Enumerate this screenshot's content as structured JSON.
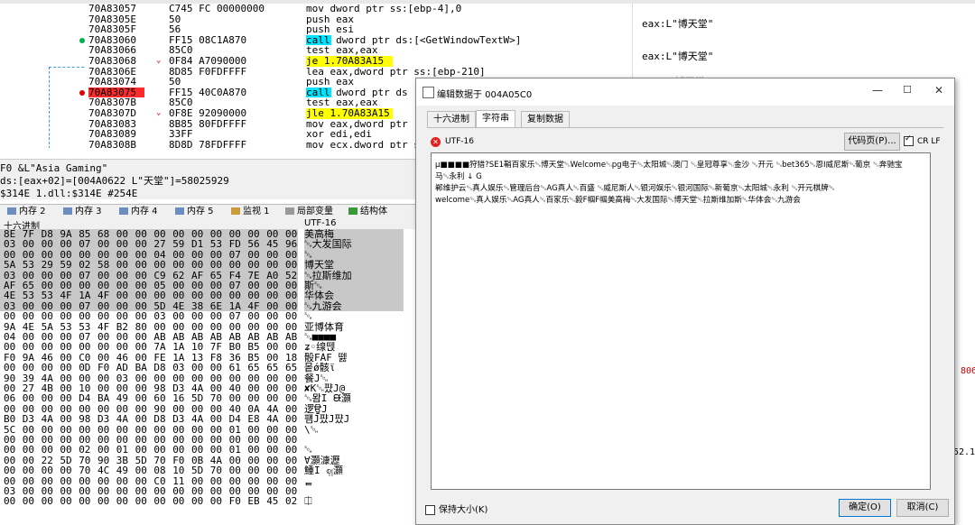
{
  "disasm": [
    {
      "addr": "70A83057",
      "bytes": "C745 FC 00000000",
      "ins": "mov dword ptr ss:[ebp-4],0",
      "call": false,
      "jmp": false,
      "dot": ""
    },
    {
      "addr": "70A8305E",
      "bytes": "50",
      "ins": "push eax",
      "call": false,
      "jmp": false,
      "dot": ""
    },
    {
      "addr": "70A8305F",
      "bytes": "56",
      "ins": "push esi",
      "call": false,
      "jmp": false,
      "dot": ""
    },
    {
      "addr": "70A83060",
      "bytes": "FF15 08C1A870",
      "ins": "call dword ptr ds:[<GetWindowTextW>]",
      "call": true,
      "jmp": false,
      "dot": "green"
    },
    {
      "addr": "70A83066",
      "bytes": "85C0",
      "ins": "test eax,eax",
      "call": false,
      "jmp": false,
      "dot": ""
    },
    {
      "addr": "70A83068",
      "bytes": "0F84 A7090000",
      "ins": "je 1.70A83A15",
      "call": false,
      "jmp": true,
      "dot": ""
    },
    {
      "addr": "70A8306E",
      "bytes": "8D85 F0FDFFFF",
      "ins": "lea eax,dword ptr ss:[ebp-210]",
      "call": false,
      "jmp": false,
      "dot": ""
    },
    {
      "addr": "70A83074",
      "bytes": "50",
      "ins": "push eax",
      "call": false,
      "jmp": false,
      "dot": ""
    },
    {
      "addr": "70A83075",
      "bytes": "FF15 40C0A870",
      "ins": "call dword ptr ds",
      "call": true,
      "jmp": false,
      "dot": "red"
    },
    {
      "addr": "70A8307B",
      "bytes": "85C0",
      "ins": "test eax,eax",
      "call": false,
      "jmp": false,
      "dot": ""
    },
    {
      "addr": "70A8307D",
      "bytes": "0F8E 92090000",
      "ins": "jle 1.70A83A15",
      "call": false,
      "jmp": true,
      "dot": ""
    },
    {
      "addr": "70A83083",
      "bytes": "8B85 80FDFFFF",
      "ins": "mov eax,dword ptr",
      "call": false,
      "jmp": false,
      "dot": ""
    },
    {
      "addr": "70A83089",
      "bytes": "33FF",
      "ins": "xor edi,edi",
      "call": false,
      "jmp": false,
      "dot": ""
    },
    {
      "addr": "70A8308B",
      "bytes": "8D8D 78FDFFFF",
      "ins": "mov ecx,dword ptr ss:[e",
      "call": false,
      "jmp": false,
      "dot": ""
    }
  ],
  "regs": [
    "eax:L\"博天堂\"",
    "eax:L\"博天堂\"",
    "\"博天堂\""
  ],
  "info": [
    "F0 &L\"Asia Gaming\"",
    "ds:[eax+02]=[004A0622 L\"天堂\"]=58025929",
    "$314E 1.dll:$314E #254E"
  ],
  "memtabs": [
    "内存 2",
    "内存 3",
    "内存 4",
    "内存 5",
    "监视 1",
    "局部变量",
    "结构体"
  ],
  "hex_header": {
    "left": "十六进制",
    "right": "UTF-16"
  },
  "hex_rows": [
    {
      "b": [
        "8E",
        "7F",
        "D8",
        "9A",
        "85",
        "68",
        "00",
        "00",
        "00",
        "00",
        "00",
        "00",
        "00",
        "00",
        "00",
        "00"
      ],
      "u": "美高梅"
    },
    {
      "b": [
        "03",
        "00",
        "00",
        "00",
        "07",
        "00",
        "00",
        "00",
        "27",
        "59",
        "D1",
        "53",
        "FD",
        "56",
        "45",
        "96"
      ],
      "u": "␁大发国际"
    },
    {
      "b": [
        "00",
        "00",
        "00",
        "00",
        "00",
        "00",
        "00",
        "00",
        "04",
        "00",
        "00",
        "00",
        "07",
        "00",
        "00",
        "00"
      ],
      "u": "␁"
    },
    {
      "b": [
        "5A",
        "53",
        "29",
        "59",
        "02",
        "58",
        "00",
        "00",
        "00",
        "00",
        "00",
        "00",
        "00",
        "00",
        "00",
        "00"
      ],
      "u": "博天堂"
    },
    {
      "b": [
        "03",
        "00",
        "00",
        "00",
        "07",
        "00",
        "00",
        "00",
        "C9",
        "62",
        "AF",
        "65",
        "F4",
        "7E",
        "A0",
        "52"
      ],
      "u": "␁拉斯维加"
    },
    {
      "b": [
        "AF",
        "65",
        "00",
        "00",
        "00",
        "00",
        "00",
        "00",
        "05",
        "00",
        "00",
        "00",
        "07",
        "00",
        "00",
        "00"
      ],
      "u": "斯␁"
    },
    {
      "b": [
        "4E",
        "53",
        "53",
        "4F",
        "1A",
        "4F",
        "00",
        "00",
        "00",
        "00",
        "00",
        "00",
        "00",
        "00",
        "00",
        "00"
      ],
      "u": "华体会"
    },
    {
      "b": [
        "03",
        "00",
        "00",
        "00",
        "07",
        "00",
        "00",
        "00",
        "5D",
        "4E",
        "38",
        "6E",
        "1A",
        "4F",
        "00",
        "00"
      ],
      "u": "␁九游会"
    },
    {
      "b": [
        "00",
        "00",
        "00",
        "00",
        "00",
        "00",
        "00",
        "00",
        "03",
        "00",
        "00",
        "00",
        "07",
        "00",
        "00",
        "00"
      ],
      "u": "␁"
    },
    {
      "b": [
        "9A",
        "4E",
        "5A",
        "53",
        "53",
        "4F",
        "B2",
        "80",
        "00",
        "00",
        "00",
        "00",
        "00",
        "00",
        "00",
        "00"
      ],
      "u": "亚博体育"
    },
    {
      "b": [
        "04",
        "00",
        "00",
        "00",
        "07",
        "00",
        "00",
        "00",
        "AB",
        "AB",
        "AB",
        "AB",
        "AB",
        "AB",
        "AB",
        "AB"
      ],
      "u": "␁■■■■"
    },
    {
      "b": [
        "00",
        "00",
        "00",
        "00",
        "00",
        "00",
        "00",
        "00",
        "7A",
        "1A",
        "10",
        "7F",
        "B0",
        "B5",
        "00",
        "00"
      ],
      "u": "ʑ◦缐뗁"
    },
    {
      "b": [
        "F0",
        "9A",
        "46",
        "00",
        "C0",
        "00",
        "46",
        "00",
        "FE",
        "1A",
        "13",
        "F8",
        "36",
        "B5",
        "00",
        "18"
      ],
      "u": "骰FÀF︚ 뗋"
    },
    {
      "b": [
        "00",
        "00",
        "00",
        "00",
        "0D",
        "F0",
        "AD",
        "BA",
        "D8",
        "03",
        "00",
        "00",
        "61",
        "65",
        "65",
        "65"
      ],
      "u": "뫁ǿ骸ϊ"
    },
    {
      "b": [
        "90",
        "39",
        "4A",
        "00",
        "00",
        "00",
        "03",
        "00",
        "00",
        "00",
        "00",
        "00",
        "00",
        "00",
        "00",
        "00"
      ],
      "u": "餐J␁"
    },
    {
      "b": [
        "00",
        "27",
        "4B",
        "00",
        "10",
        "00",
        "00",
        "00",
        "98",
        "D3",
        "4A",
        "00",
        "40",
        "00",
        "00",
        "00"
      ],
      "u": "✘K␁퍘J@"
    },
    {
      "b": [
        "06",
        "00",
        "00",
        "00",
        "D4",
        "BA",
        "49",
        "00",
        "60",
        "16",
        "5D",
        "70",
        "00",
        "00",
        "00",
        "00"
      ],
      "u": "␁뫔I ᙠ灝"
    },
    {
      "b": [
        "00",
        "00",
        "00",
        "00",
        "00",
        "00",
        "00",
        "00",
        "90",
        "00",
        "00",
        "00",
        "40",
        "0A",
        "4A",
        "00"
      ],
      "u": "逻ਊJ"
    },
    {
      "b": [
        "B0",
        "D3",
        "4A",
        "00",
        "98",
        "D3",
        "4A",
        "00",
        "D8",
        "D3",
        "4A",
        "00",
        "D4",
        "E8",
        "4A",
        "00"
      ],
      "u": "퍰J퍘J퍘J"
    },
    {
      "b": [
        "5C",
        "00",
        "00",
        "00",
        "00",
        "00",
        "00",
        "00",
        "00",
        "00",
        "00",
        "00",
        "01",
        "00",
        "00",
        "00"
      ],
      "u": "\\␁"
    },
    {
      "b": [
        "00",
        "00",
        "00",
        "00",
        "00",
        "00",
        "00",
        "00",
        "00",
        "00",
        "00",
        "00",
        "00",
        "00",
        "00",
        "00"
      ],
      "u": ""
    },
    {
      "b": [
        "00",
        "00",
        "00",
        "00",
        "02",
        "00",
        "01",
        "00",
        "00",
        "00",
        "00",
        "00",
        "01",
        "00",
        "00",
        "00"
      ],
      "u": "␁"
    },
    {
      "b": [
        "00",
        "00",
        "22",
        "5D",
        "70",
        "90",
        "3B",
        "5D",
        "70",
        "F0",
        "0B",
        "4A",
        "00",
        "00",
        "00",
        "00"
      ],
      "u": "∀灝漮瀝"
    },
    {
      "b": [
        "00",
        "00",
        "00",
        "00",
        "70",
        "4C",
        "49",
        "00",
        "08",
        "10",
        "5D",
        "70",
        "00",
        "00",
        "00",
        "00"
      ],
      "u": "䱰I ဈ灝"
    },
    {
      "b": [
        "00",
        "00",
        "00",
        "00",
        "00",
        "00",
        "00",
        "00",
        "C0",
        "11",
        "00",
        "00",
        "00",
        "00",
        "00",
        "00"
      ],
      "u": "ᇀ"
    },
    {
      "b": [
        "03",
        "00",
        "00",
        "00",
        "00",
        "00",
        "00",
        "00",
        "00",
        "00",
        "00",
        "00",
        "00",
        "00",
        "00",
        "00"
      ],
      "u": ""
    },
    {
      "b": [
        "00",
        "00",
        "00",
        "00",
        "00",
        "00",
        "00",
        "00",
        "00",
        "00",
        "00",
        "00",
        "F0",
        "EB",
        "45",
        "02"
      ],
      "u": "⎅"
    }
  ],
  "dialog": {
    "title": "编辑数据于 004A05C0",
    "tabs": [
      "十六进制",
      "字符串",
      "复制数据"
    ],
    "encoding": "UTF-16",
    "codepage_button": "代码页(P)...",
    "crlf_label": "CR LF",
    "lines": [
      "μ■■■■狩猎?SE1鞘百家乐␁博天堂␁Welcome␁pg电子␁太阳城␁澳门 ␁皇冠尊享␁金沙 ␁开元 ␁bet365␁恩I威尼斯␁葡京 ␁奔驰宝",
      "马␁永利 ↓  G",
      "郸维护云␁真人娱乐␁管理后台␁AG真人␁百盛 ␁威尼斯人␁银河娱乐␁银河国际␁新葡京␁太阳城␁永利 ␁开元棋牌␁",
      "welcome␁真人娱乐␁AG真人␁百家乐␁毅F帼F帼美高梅␁大发国际␁博天堂␁拉斯维加斯␁华体会␁九游会"
    ],
    "keep_size_label": "保持大小(K)",
    "ok_label": "确定(O)",
    "cancel_label": "取消(C)"
  },
  "right_edge": [
    "806",
    "52.1"
  ]
}
